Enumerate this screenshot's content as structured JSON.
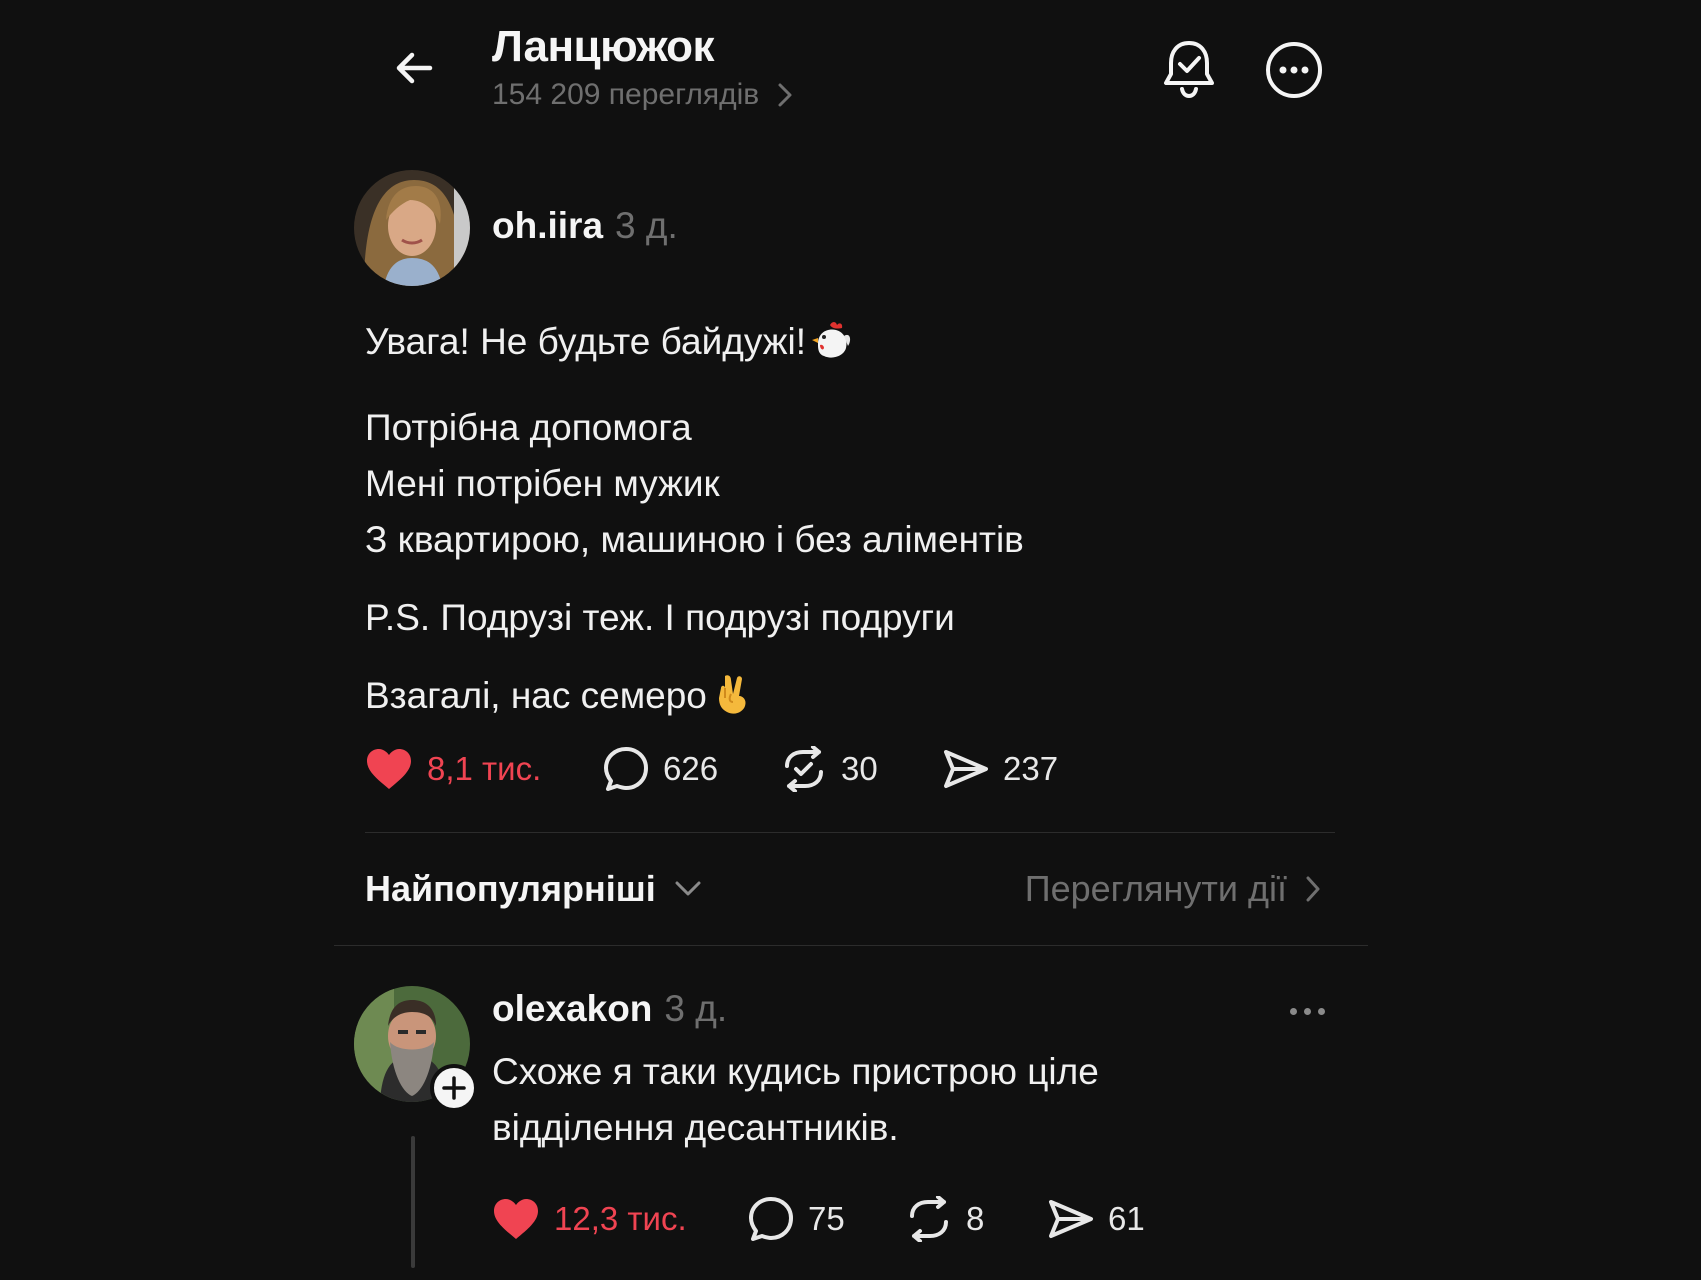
{
  "header": {
    "title": "Ланцюжок",
    "views": "154 209 переглядів"
  },
  "post": {
    "username": "oh.iira",
    "time": "3 д.",
    "lines": [
      "Увага! Не будьте байдужі!",
      "Потрібна допомога",
      "Мені потрібен мужик",
      "З квартирою, машиною і без аліментів",
      "P.S. Подрузі теж. І подрузі подруги",
      "Взагалі, нас семеро"
    ],
    "likes": "8,1 тис.",
    "comments": "626",
    "reposts": "30",
    "shares": "237"
  },
  "sort": {
    "label": "Найпопулярніші",
    "view_activity": "Переглянути дії"
  },
  "reply": {
    "username": "olexakon",
    "time": "3 д.",
    "text_line1": "Схоже я таки кудись пристрою ціле",
    "text_line2": "відділення десантників.",
    "likes": "12,3 тис.",
    "comments": "75",
    "reposts": "8",
    "shares": "61"
  },
  "colors": {
    "background": "#101010",
    "like_red": "#f04452",
    "muted": "#6f6f6f"
  },
  "icons": [
    "back-arrow-icon",
    "bell-check-icon",
    "more-circle-icon",
    "heart-icon",
    "comment-icon",
    "repost-icon",
    "share-icon",
    "chevron-down-icon",
    "chevron-right-icon",
    "plus-icon",
    "chicken-emoji",
    "crossed-fingers-emoji"
  ]
}
